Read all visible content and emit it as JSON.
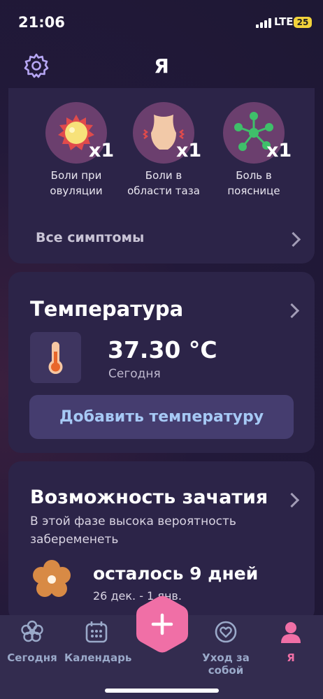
{
  "status": {
    "time": "21:06",
    "network": "LTE",
    "battery": "25"
  },
  "header": {
    "title": "Я"
  },
  "symptoms": {
    "items": [
      {
        "label": "Боли при овуляции",
        "count": "x1"
      },
      {
        "label": "Боли в области таза",
        "count": "x1"
      },
      {
        "label": "Боль в пояснице",
        "count": "x1"
      }
    ],
    "all_label": "Все симптомы"
  },
  "temperature": {
    "title": "Температура",
    "value": "37.30 °C",
    "date": "Сегодня",
    "add_button": "Добавить температуру"
  },
  "conception": {
    "title": "Возможность зачатия",
    "description": "В этой фазе высока вероятность забеременеть",
    "days_left": "осталось 9 дней",
    "range": "26 дек. - 1 янв."
  },
  "tabs": [
    {
      "label": "Сегодня",
      "icon": "flower-icon",
      "active": false
    },
    {
      "label": "Календарь",
      "icon": "calendar-icon",
      "active": false
    },
    {
      "label": "Уход за собой",
      "icon": "selfcare-heart-icon",
      "active": false
    },
    {
      "label": "Я",
      "icon": "profile-icon",
      "active": true
    }
  ],
  "colors": {
    "background": "#22193a",
    "card": "#2c2448",
    "accent_pink": "#f06fa6",
    "button_text": "#a6c9f5",
    "tab_inactive": "#9aa9c9"
  }
}
